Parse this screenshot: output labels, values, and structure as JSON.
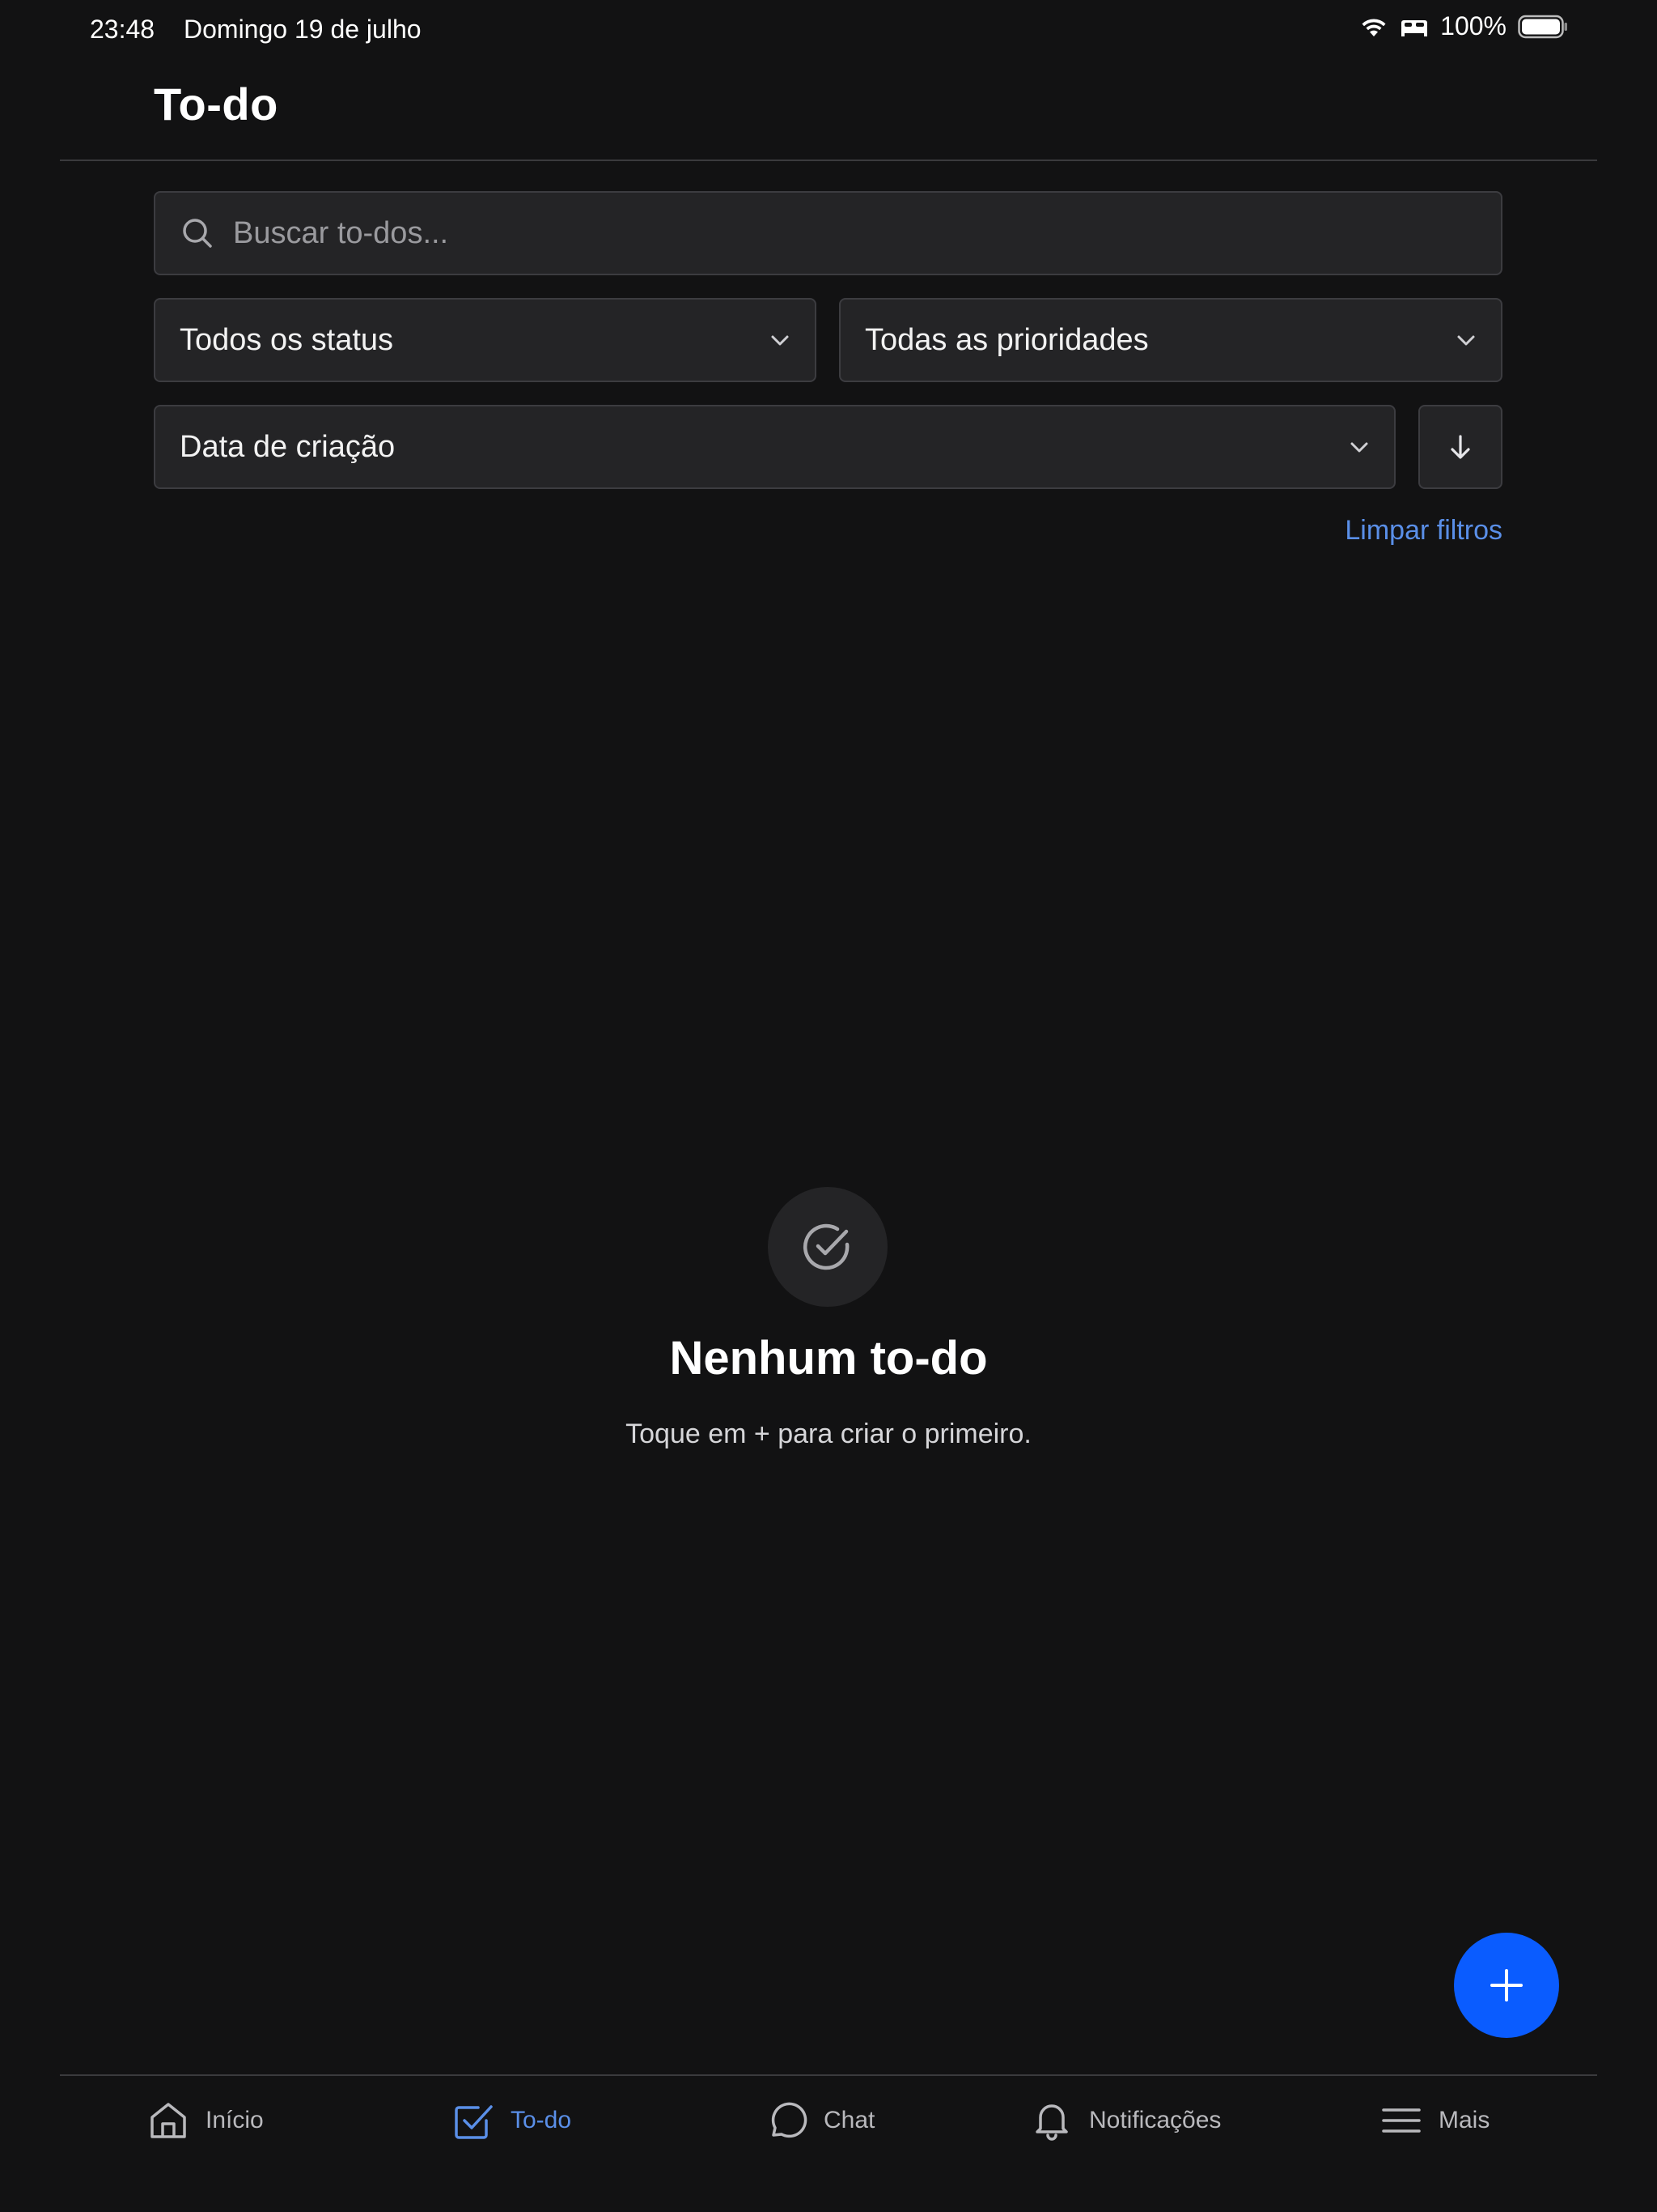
{
  "status_bar": {
    "time": "23:48",
    "date": "Domingo 19 de julho",
    "battery": "100%",
    "icons": [
      "wifi-icon",
      "bed-icon",
      "battery-icon"
    ]
  },
  "header": {
    "title": "To-do"
  },
  "filters": {
    "search_placeholder": "Buscar to-dos...",
    "search_value": "",
    "status_select": "Todos os status",
    "priority_select": "Todas as prioridades",
    "sort_select": "Data de criação",
    "sort_direction_icon": "arrow-down-icon",
    "clear_label": "Limpar filtros"
  },
  "empty_state": {
    "icon": "check-circle-icon",
    "title": "Nenhum to-do",
    "subtitle": "Toque em + para criar o primeiro."
  },
  "fab": {
    "icon": "plus-icon"
  },
  "nav": {
    "items": [
      {
        "label": "Início",
        "icon": "home-icon",
        "active": false
      },
      {
        "label": "To-do",
        "icon": "checkbox-icon",
        "active": true
      },
      {
        "label": "Chat",
        "icon": "chat-bubble-icon",
        "active": false
      },
      {
        "label": "Notificações",
        "icon": "bell-icon",
        "active": false
      },
      {
        "label": "Mais",
        "icon": "menu-icon",
        "active": false
      }
    ]
  },
  "colors": {
    "background": "#121213",
    "surface": "#242426",
    "accent": "#5a8fe8",
    "fab": "#0a5cff"
  }
}
